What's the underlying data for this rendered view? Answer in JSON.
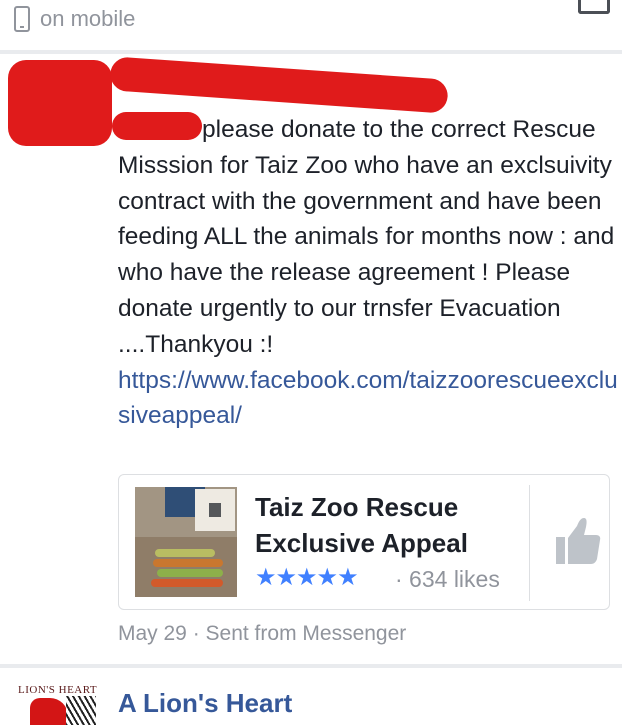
{
  "header": {
    "status": "on mobile",
    "icons": {
      "device": "phone-icon",
      "share": "share-icon"
    }
  },
  "post": {
    "message": "please donate to the correct Rescue Misssion for Taiz Zoo who have an exclsuivity contract with the government and have been feeding ALL the animals for months now : and who have the release agreement ! Please donate urgently to our trnsfer Evacuation ....Thankyou :!",
    "link": "https://www.facebook.com/taizzoorescueexclusiveappeal/",
    "meta": "May 29 · Sent from Messenger"
  },
  "card": {
    "title": "Taiz Zoo Rescue Exclusive Appeal",
    "stars": "★★★★★",
    "rating": 5,
    "likes": "· 634 likes",
    "like_icon": "thumbs-up-icon"
  },
  "next_item": {
    "logo_text": "LION'S HEART",
    "name": "A Lion's Heart"
  },
  "colors": {
    "link": "#365899",
    "muted": "#90949c",
    "star": "#4080ff",
    "redaction": "#e01b1b"
  }
}
